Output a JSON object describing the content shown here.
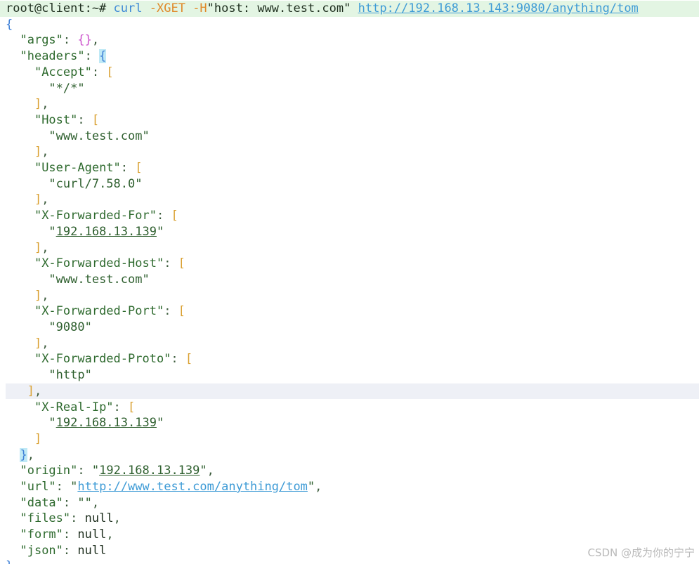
{
  "terminal": {
    "prompt": "root@client:~#",
    "command": {
      "program": "curl",
      "method_flag": "-XGET",
      "header_flag": "-H",
      "header_value": "\"host: www.test.com\"",
      "url": "http://192.168.13.143:9080/anything/tom"
    },
    "keys": {
      "args": "\"args\"",
      "headers": "\"headers\"",
      "accept": "\"Accept\"",
      "host": "\"Host\"",
      "user_agent": "\"User-Agent\"",
      "x_forwarded_for": "\"X-Forwarded-For\"",
      "x_forwarded_host": "\"X-Forwarded-Host\"",
      "x_forwarded_port": "\"X-Forwarded-Port\"",
      "x_forwarded_proto": "\"X-Forwarded-Proto\"",
      "x_real_ip": "\"X-Real-Ip\"",
      "origin": "\"origin\"",
      "url": "\"url\"",
      "data": "\"data\"",
      "files": "\"files\"",
      "form": "\"form\"",
      "json": "\"json\""
    },
    "values": {
      "args": "{}",
      "accept": "*/*",
      "host": "www.test.com",
      "user_agent": "curl/7.58.0",
      "x_forwarded_for": "192.168.13.139",
      "x_forwarded_host": "www.test.com",
      "x_forwarded_port": "9080",
      "x_forwarded_proto": "http",
      "x_real_ip": "192.168.13.139",
      "origin": "192.168.13.139",
      "url": "http://www.test.com/anything/tom",
      "data": "\"\"",
      "files": "null",
      "form": "null",
      "json": "null"
    }
  },
  "watermark": "CSDN @成为你的宁宁"
}
